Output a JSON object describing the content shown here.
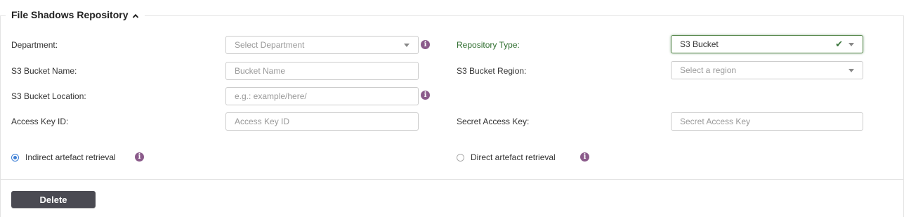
{
  "section": {
    "title": "File Shadows Repository",
    "toggle_icon": "chevron-up-icon"
  },
  "form": {
    "department": {
      "label": "Department:",
      "placeholder": "Select Department",
      "value": ""
    },
    "repository_type": {
      "label": "Repository Type:",
      "value": "S3 Bucket",
      "valid": true
    },
    "bucket_name": {
      "label": "S3 Bucket Name:",
      "placeholder": "Bucket Name",
      "value": ""
    },
    "bucket_region": {
      "label": "S3 Bucket Region:",
      "placeholder": "Select a region",
      "value": ""
    },
    "bucket_location": {
      "label": "S3 Bucket Location:",
      "placeholder": "e.g.: example/here/",
      "value": ""
    },
    "access_key_id": {
      "label": "Access Key ID:",
      "placeholder": "Access Key ID",
      "value": ""
    },
    "secret_access_key": {
      "label": "Secret Access Key:",
      "placeholder": "Secret Access Key",
      "value": ""
    },
    "retrieval": {
      "options": [
        {
          "label": "Indirect artefact retrieval",
          "checked": true
        },
        {
          "label": "Direct artefact retrieval",
          "checked": false
        }
      ]
    }
  },
  "icons": {
    "info": "i",
    "check": "✔"
  },
  "actions": {
    "delete_label": "Delete"
  },
  "colors": {
    "info_icon": "#8b5b8b",
    "valid_green": "#3c763d",
    "button_bg": "#4a4a52",
    "radio_selected": "#3d7fd6"
  }
}
